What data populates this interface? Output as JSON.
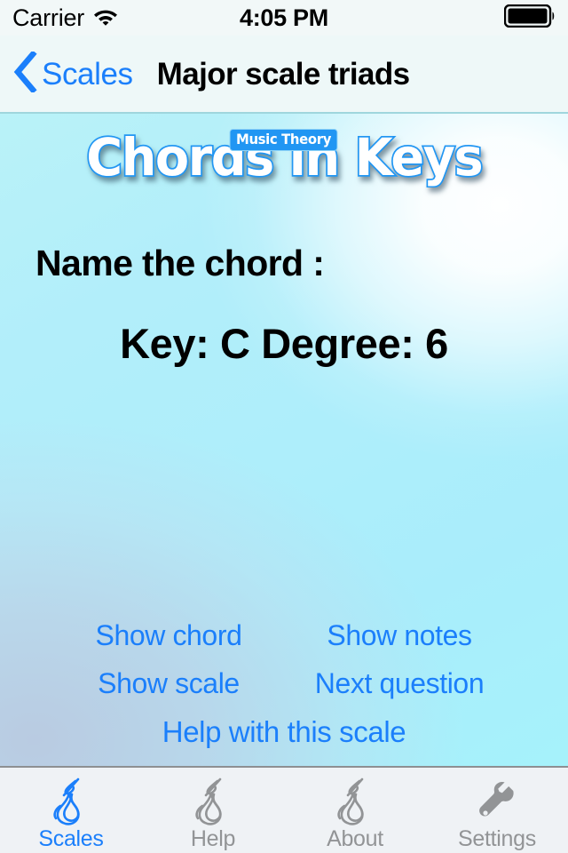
{
  "status_bar": {
    "carrier": "Carrier",
    "wifi_icon": "wifi-icon",
    "time": "4:05 PM",
    "battery_icon": "battery-full-icon"
  },
  "nav_bar": {
    "back_icon": "chevron-left-icon",
    "back_label": "Scales",
    "title": "Major scale triads"
  },
  "logo": {
    "sub_text": "Music Theory",
    "main_text": "Chords in Keys",
    "outline_color": "#2196f3",
    "fill_color": "#ffffff"
  },
  "question": {
    "prompt": "Name the chord :",
    "answer_line": "Key: C  Degree: 6",
    "key": "C",
    "degree": "6"
  },
  "actions": {
    "show_chord": "Show chord",
    "show_notes": "Show notes",
    "show_scale": "Show scale",
    "next_question": "Next question",
    "help_with_scale": "Help with this scale",
    "link_color": "#1b7ffb"
  },
  "tab_bar": {
    "active_color": "#1b7ffb",
    "inactive_color": "#929496",
    "items": [
      {
        "label": "Scales",
        "icon": "guitar-icon",
        "active": true
      },
      {
        "label": "Help",
        "icon": "guitar-icon",
        "active": false
      },
      {
        "label": "About",
        "icon": "guitar-icon",
        "active": false
      },
      {
        "label": "Settings",
        "icon": "wrench-icon",
        "active": false
      }
    ]
  }
}
